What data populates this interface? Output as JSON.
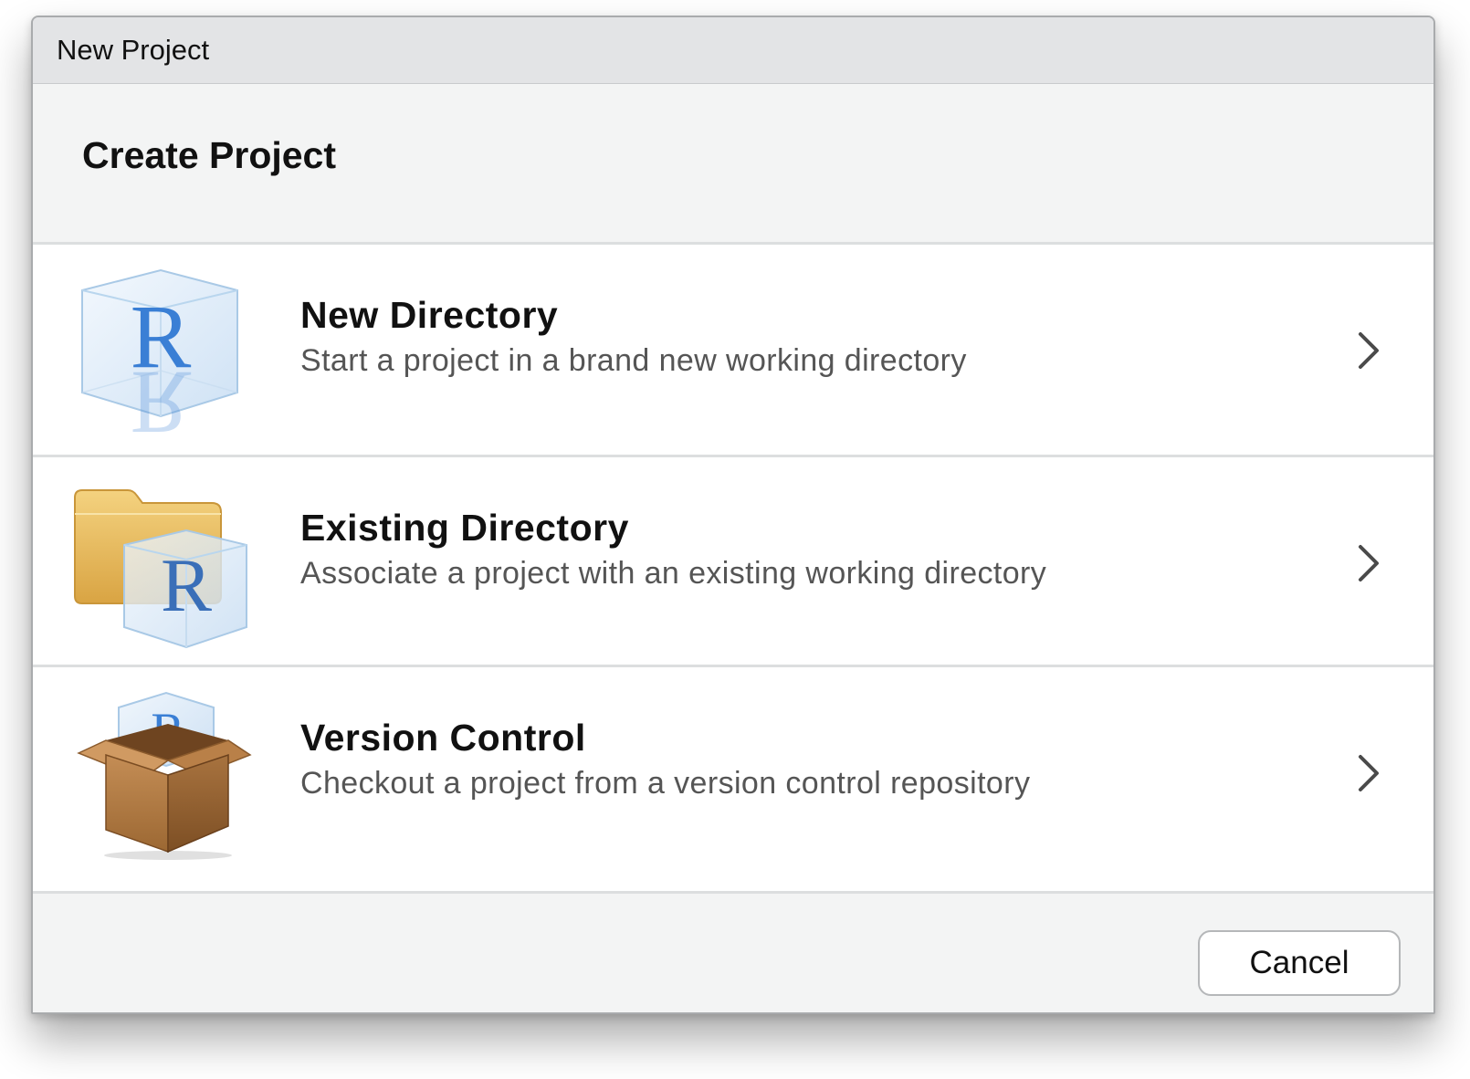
{
  "window": {
    "title": "New Project"
  },
  "header": {
    "heading": "Create Project"
  },
  "options": [
    {
      "title": "New Directory",
      "description": "Start a project in a brand new working directory",
      "icon": "r-cube-icon"
    },
    {
      "title": "Existing Directory",
      "description": "Associate a project with an existing working directory",
      "icon": "folder-r-icon"
    },
    {
      "title": "Version Control",
      "description": "Checkout a project from a version control repository",
      "icon": "box-r-icon"
    }
  ],
  "footer": {
    "cancel_label": "Cancel"
  },
  "colors": {
    "r_blue": "#2d6fcc",
    "folder": "#e6b654",
    "box": "#b07a43"
  },
  "icon_letter": "R"
}
